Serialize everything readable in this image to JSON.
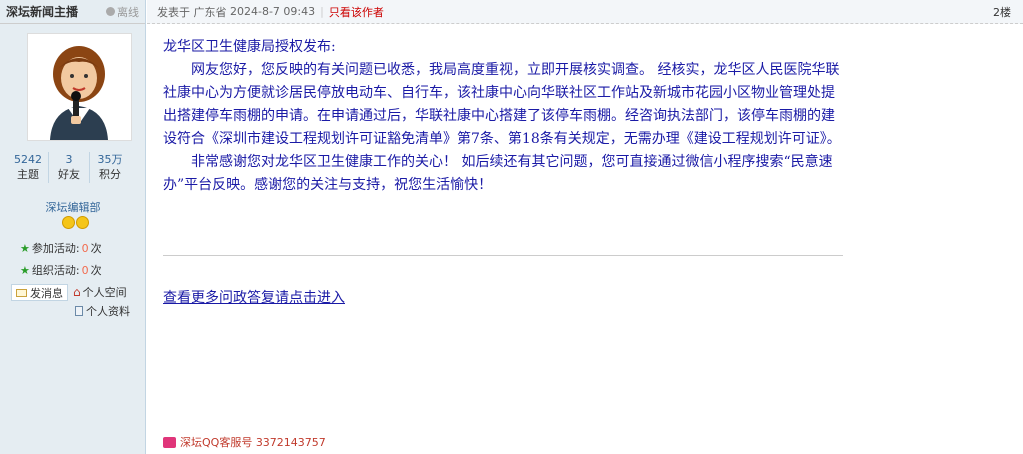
{
  "author": {
    "name": "深坛新闻主播",
    "status": "离线",
    "stats": [
      {
        "num": "5242",
        "label": "主题"
      },
      {
        "num": "3",
        "label": "好友"
      },
      {
        "num": "35万",
        "label": "积分"
      }
    ],
    "group": "深坛编辑部",
    "activities": [
      {
        "label": "参加活动:",
        "count": "0",
        "unit": "次"
      },
      {
        "label": "组织活动:",
        "count": "0",
        "unit": "次"
      }
    ],
    "send_message": "发消息",
    "space": "个人空间",
    "profile": "个人资料"
  },
  "post": {
    "posted_prefix": "发表于",
    "location": "广东省",
    "datetime": "2024-8-7 09:43",
    "only_author": "只看该作者",
    "floor": "2楼",
    "paragraphs": [
      "龙华区卫生健康局授权发布:",
      "网友您好，您反映的有关问题已收悉，我局高度重视，立即开展核实调查。 经核实，龙华区人民医院华联社康中心为方便就诊居民停放电动车、自行车，该社康中心向华联社区工作站及新城市花园小区物业管理处提出搭建停车雨棚的申请。在申请通过后，华联社康中心搭建了该停车雨棚。经咨询执法部门，该停车雨棚的建设符合《深圳市建设工程规划许可证豁免清单》第7条、第18条有关规定，无需办理《建设工程规划许可证》。",
      "非常感谢您对龙华区卫生健康工作的关心！ 如后续还有其它问题，您可直接通过微信小程序搜索“民意速办”平台反映。感谢您的关注与支持，祝您生活愉快！"
    ],
    "more_link": "查看更多问政答复请点击进入",
    "qq_service": "深坛QQ客服号 3372143757"
  }
}
